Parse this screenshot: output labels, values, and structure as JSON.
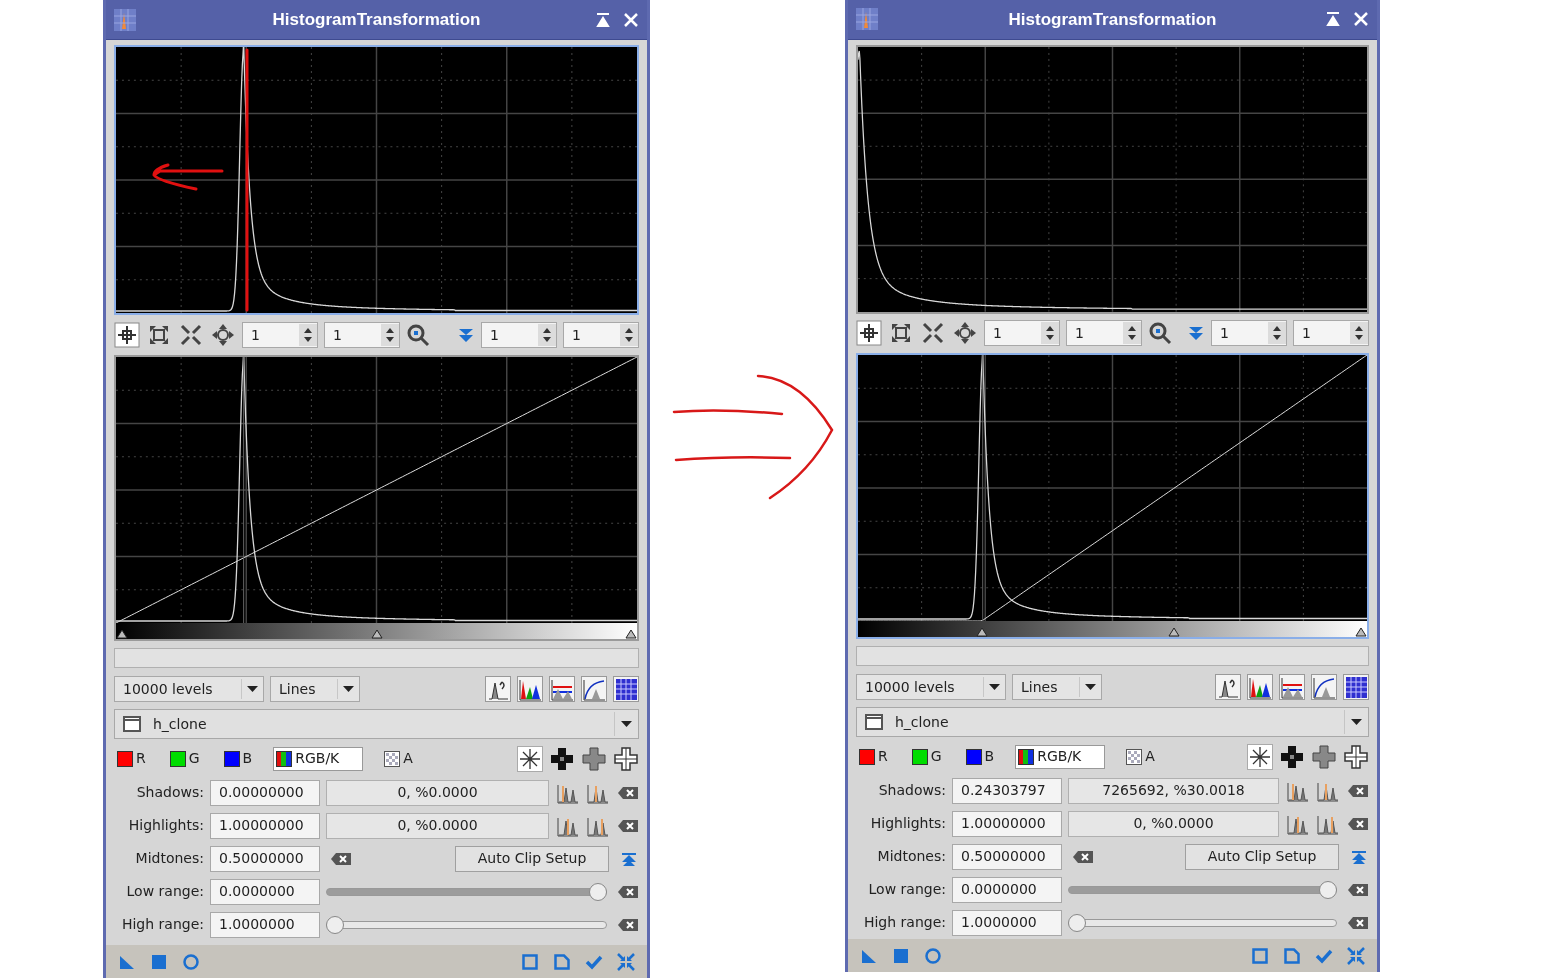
{
  "windows": [
    {
      "title": "HistogramTransformation",
      "annotated": true,
      "preview_focused": true,
      "transform_focused": false,
      "preview_zoom": [
        "1",
        "1"
      ],
      "transform_zoom": [
        "1",
        "1"
      ],
      "resolution": "10000 levels",
      "graph_style": "Lines",
      "view": "h_clone",
      "channels": [
        {
          "label": "R",
          "kind": "color",
          "color": "#ff0000",
          "selected": false
        },
        {
          "label": "G",
          "kind": "color",
          "color": "#00dd00",
          "selected": false
        },
        {
          "label": "B",
          "kind": "color",
          "color": "#0000ff",
          "selected": false
        },
        {
          "label": "RGB/K",
          "kind": "combined",
          "selected": true
        },
        {
          "label": "A",
          "kind": "alpha",
          "selected": false
        }
      ],
      "params": [
        {
          "kind": "clip",
          "label": "Shadows:",
          "value": "0.00000000",
          "clipping": "0, %0.0000"
        },
        {
          "kind": "clip",
          "label": "Highlights:",
          "value": "1.00000000",
          "clipping": "0, %0.0000"
        },
        {
          "kind": "midtones",
          "label": "Midtones:",
          "value": "0.50000000",
          "button": "Auto Clip Setup"
        },
        {
          "kind": "range",
          "label": "Low range:",
          "value": "0.0000000",
          "level": 1
        },
        {
          "kind": "range",
          "label": "High range:",
          "value": "1.0000000",
          "level": 0
        }
      ]
    },
    {
      "title": "HistogramTransformation",
      "annotated": false,
      "preview_focused": false,
      "transform_focused": true,
      "preview_zoom": [
        "1",
        "1"
      ],
      "transform_zoom": [
        "1",
        "1"
      ],
      "resolution": "10000 levels",
      "graph_style": "Lines",
      "view": "h_clone",
      "channels": [
        {
          "label": "R",
          "kind": "color",
          "color": "#ff0000",
          "selected": false
        },
        {
          "label": "G",
          "kind": "color",
          "color": "#00dd00",
          "selected": false
        },
        {
          "label": "B",
          "kind": "color",
          "color": "#0000ff",
          "selected": false
        },
        {
          "label": "RGB/K",
          "kind": "combined",
          "selected": true
        },
        {
          "label": "A",
          "kind": "alpha",
          "selected": false
        }
      ],
      "params": [
        {
          "kind": "clip",
          "label": "Shadows:",
          "value": "0.24303797",
          "clipping": "7265692, %30.0018"
        },
        {
          "kind": "clip",
          "label": "Highlights:",
          "value": "1.00000000",
          "clipping": "0, %0.0000"
        },
        {
          "kind": "midtones",
          "label": "Midtones:",
          "value": "0.50000000",
          "button": "Auto Clip Setup"
        },
        {
          "kind": "range",
          "label": "Low range:",
          "value": "0.0000000",
          "level": 1
        },
        {
          "kind": "range",
          "label": "High range:",
          "value": "1.0000000",
          "level": 0
        }
      ]
    }
  ]
}
